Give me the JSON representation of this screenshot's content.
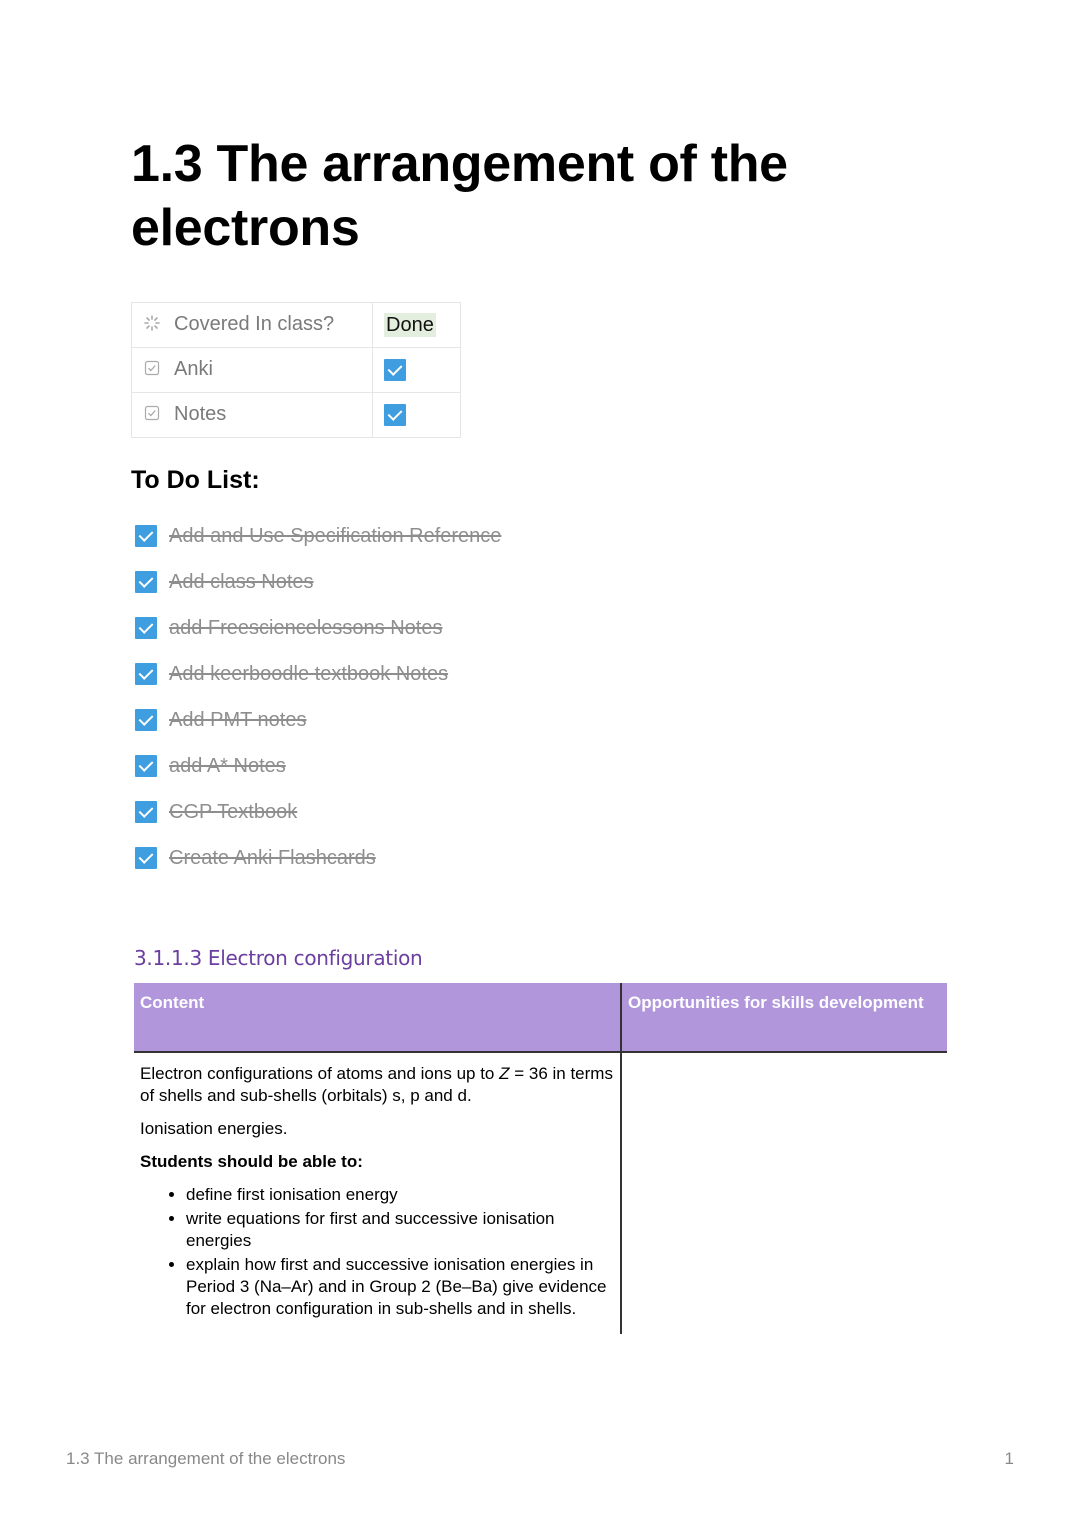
{
  "title": "1.3 The arrangement of the electrons",
  "properties": [
    {
      "icon": "loading-status-icon",
      "label": "Covered In class?",
      "value": "Done",
      "type": "status"
    },
    {
      "icon": "checkbox-property-icon",
      "label": "Anki",
      "value": true,
      "type": "checkbox"
    },
    {
      "icon": "checkbox-property-icon",
      "label": "Notes",
      "value": true,
      "type": "checkbox"
    }
  ],
  "todo": {
    "heading": "To Do List:",
    "items": [
      {
        "text": "Add and Use Specification Reference",
        "checked": true
      },
      {
        "text": "Add class Notes",
        "checked": true
      },
      {
        "text": "add Freesciencelessons Notes",
        "checked": true
      },
      {
        "text": "Add keerboodle textbook Notes",
        "checked": true
      },
      {
        "text": "Add PMT notes",
        "checked": true
      },
      {
        "text": "add A* Notes",
        "checked": true
      },
      {
        "text": "CGP Textbook ",
        "checked": true
      },
      {
        "text": "Create Anki Flashcards",
        "checked": true
      }
    ]
  },
  "spec": {
    "heading": "3.1.1.3 Electron configuration",
    "col1": "Content",
    "col2": "Opportunities for skills development",
    "para1_a": "Electron configurations of atoms and ions up to ",
    "para1_z": "Z",
    "para1_b": " = 36 in terms of shells and sub-shells (orbitals) s, p and d.",
    "para2": "Ionisation energies.",
    "para3": "Students should be able to:",
    "bullets": [
      "define first ionisation energy",
      "write equations for first and successive ionisation energies",
      "explain how first and successive ionisation energies in Period 3 (Na–Ar) and in Group 2 (Be–Ba) give evidence for electron configuration in sub-shells and in shells."
    ]
  },
  "footer": {
    "text": "1.3 The arrangement of the electrons",
    "page": "1"
  }
}
